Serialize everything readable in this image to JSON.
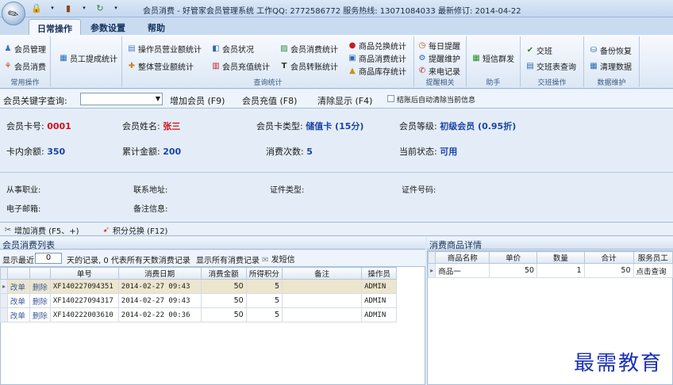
{
  "window": {
    "title": "会员消费 - 好管家会员管理系统 工作QQ: 2772586772 服务热线: 13071084033 最新修订: 2014-04-22"
  },
  "tabs": [
    "日常操作",
    "参数设置",
    "帮助"
  ],
  "ribbon": {
    "groups": [
      {
        "caption": "常用操作",
        "buttons": [
          "会员管理",
          "会员消费"
        ]
      },
      {
        "caption": "",
        "buttons": [
          "员工提成统计"
        ]
      },
      {
        "caption": "查询统计",
        "buttons": [
          "操作员营业额统计",
          "整体营业额统计",
          "会员状况",
          "会员充值统计",
          "会员消费统计",
          "会员转账统计",
          "商品兑换统计",
          "商品消费统计",
          "商品库存统计"
        ]
      },
      {
        "caption": "提醒相关",
        "buttons": [
          "每日提醒",
          "提醒维护",
          "来电记录"
        ]
      },
      {
        "caption": "助手",
        "buttons": [
          "短信群发"
        ]
      },
      {
        "caption": "交班操作",
        "buttons": [
          "交班",
          "交班表查询"
        ]
      },
      {
        "caption": "数据维护",
        "buttons": [
          "备份恢复",
          "清理数据"
        ]
      }
    ]
  },
  "search": {
    "label": "会员关键字查询:",
    "value": "",
    "buttons": [
      "增加会员 (F9)",
      "会员充值 (F8)",
      "清除显示 (F4)"
    ],
    "checkbox_label": "结账后自动清除当前信息",
    "checked": false
  },
  "member": {
    "card_no_label": "会员卡号:",
    "card_no": "0001",
    "name_label": "会员姓名:",
    "name": "张三",
    "card_type_label": "会员卡类型:",
    "card_type": "储值卡 (15分)",
    "level_label": "会员等级:",
    "level": "初级会员 (0.95折)",
    "balance_label": "卡内余额:",
    "balance": "350",
    "total_label": "累计金额:",
    "total": "200",
    "count_label": "消费次数:",
    "count": "5",
    "status_label": "当前状态:",
    "status": "可用",
    "job_label": "从事职业:",
    "address_label": "联系地址:",
    "idtype_label": "证件类型:",
    "idno_label": "证件号码:",
    "email_label": "电子邮箱:",
    "remark_label": "备注信息:"
  },
  "actions": [
    "增加消费 (F5、+)",
    "积分兑换 (F12)"
  ],
  "consume_list": {
    "title": "会员消费列表",
    "show_recent_label": "显示最近",
    "days_value": "0",
    "days_suffix": "天的记录, 0 代表所有天数消费记录",
    "show_all": "显示所有消费记录",
    "sms": "发短信",
    "headers": [
      "单号",
      "消费日期",
      "消费金额",
      "所得积分",
      "备注",
      "操作员"
    ],
    "rows": [
      {
        "edit": "改单",
        "del": "删除",
        "no": "XF140227094351",
        "date": "2014-02-27 09:43",
        "amount": "50",
        "points": "5",
        "note": "",
        "op": "ADMIN"
      },
      {
        "edit": "改单",
        "del": "删除",
        "no": "XF140227094317",
        "date": "2014-02-27 09:43",
        "amount": "50",
        "points": "5",
        "note": "",
        "op": "ADMIN"
      },
      {
        "edit": "改单",
        "del": "删除",
        "no": "XF140222003610",
        "date": "2014-02-22 00:36",
        "amount": "50",
        "points": "5",
        "note": "",
        "op": "ADMIN"
      }
    ]
  },
  "goods_detail": {
    "title": "消费商品详情",
    "headers": [
      "商品名称",
      "单价",
      "数量",
      "合计",
      "服务员工"
    ],
    "rows": [
      {
        "name": "商品一",
        "price": "50",
        "qty": "1",
        "sum": "50",
        "staff": "点击查询"
      }
    ]
  },
  "watermark": "最需教育"
}
